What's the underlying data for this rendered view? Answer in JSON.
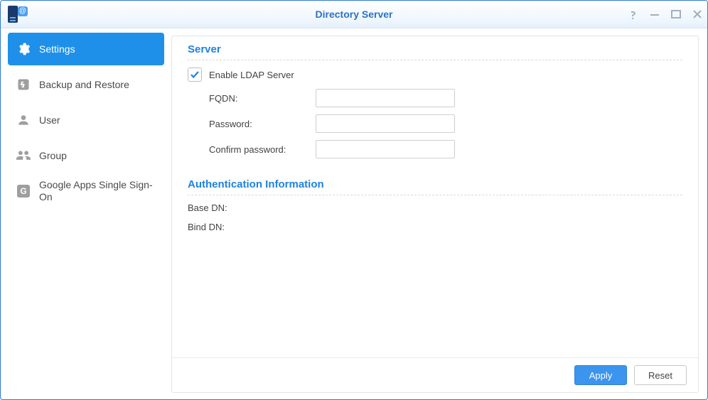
{
  "window": {
    "title": "Directory Server"
  },
  "sidebar": {
    "items": [
      {
        "label": "Settings"
      },
      {
        "label": "Backup and Restore"
      },
      {
        "label": "User"
      },
      {
        "label": "Group"
      },
      {
        "label": "Google Apps Single Sign-On"
      }
    ]
  },
  "server": {
    "section_title": "Server",
    "enable_label": "Enable LDAP Server",
    "enable_checked": true,
    "fields": {
      "fqdn_label": "FQDN:",
      "fqdn_value": "",
      "password_label": "Password:",
      "password_value": "",
      "confirm_label": "Confirm password:",
      "confirm_value": ""
    }
  },
  "auth": {
    "section_title": "Authentication Information",
    "basedn_label": "Base DN:",
    "basedn_value": "",
    "binddn_label": "Bind DN:",
    "binddn_value": ""
  },
  "footer": {
    "apply": "Apply",
    "reset": "Reset"
  }
}
